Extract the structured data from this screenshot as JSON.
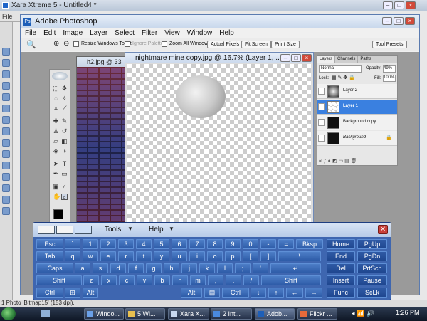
{
  "xara": {
    "title": "Xara Xtreme 5 - Untitled4 *",
    "menu": "File",
    "status": "1 Photo 'Bitmap15' (153 dpi)."
  },
  "photoshop": {
    "title": "Adobe Photoshop",
    "menu": [
      "File",
      "Edit",
      "Image",
      "Layer",
      "Select",
      "Filter",
      "View",
      "Window",
      "Help"
    ],
    "options": {
      "resize": "Resize Windows To Fit",
      "ignore": "Ignore Palettes",
      "zoom_all": "Zoom All Windows",
      "actual": "Actual Pixels",
      "fit": "Fit Screen",
      "print": "Print Size",
      "tool_presets": "Tool Presets"
    }
  },
  "docs": {
    "doc1_title": "h2.jpg @ 33",
    "doc2_title": "nightmare mine copy.jpg @ 16.7% (Layer 1, ..."
  },
  "layers": {
    "tabs": [
      "Layers",
      "Channels",
      "Paths"
    ],
    "blend": "Normal",
    "opacity_label": "Opacity:",
    "opacity": "49%",
    "lock_label": "Lock:",
    "fill_label": "Fill:",
    "fill": "100%",
    "rows": [
      {
        "name": "Layer 2"
      },
      {
        "name": "Layer 1"
      },
      {
        "name": "Background copy"
      },
      {
        "name": "Background"
      }
    ]
  },
  "osk": {
    "menus": [
      "Tools",
      "Help"
    ],
    "rows": [
      [
        "Esc",
        "`",
        "1",
        "2",
        "3",
        "4",
        "5",
        "6",
        "7",
        "8",
        "9",
        "0",
        "-",
        "=",
        "Bksp",
        "Home",
        "PgUp"
      ],
      [
        "Tab",
        "q",
        "w",
        "e",
        "r",
        "t",
        "y",
        "u",
        "i",
        "o",
        "p",
        "[",
        "]",
        "\\",
        "End",
        "PgDn"
      ],
      [
        "Caps",
        "a",
        "s",
        "d",
        "f",
        "g",
        "h",
        "j",
        "k",
        "l",
        ";",
        "'",
        "↵",
        "Del",
        "PrtScn"
      ],
      [
        "Shift",
        "z",
        "x",
        "c",
        "v",
        "b",
        "n",
        "m",
        ",",
        ".",
        "/",
        "Shift",
        "Insert",
        "Pause"
      ],
      [
        "Ctrl",
        "⊞",
        "Alt",
        "Alt",
        "▤",
        "Ctrl",
        "↓",
        "↑",
        "←",
        "→",
        "Func",
        "ScLk"
      ]
    ]
  },
  "taskbar": {
    "items": [
      "Windo...",
      "5 Wi...",
      "Xara X...",
      "2 Int...",
      "Adob...",
      "Flickr ..."
    ],
    "clock": "1:26 PM"
  },
  "colors": {
    "selected_layer": "#3a80e0",
    "osk_key": "#2e5ca8"
  }
}
